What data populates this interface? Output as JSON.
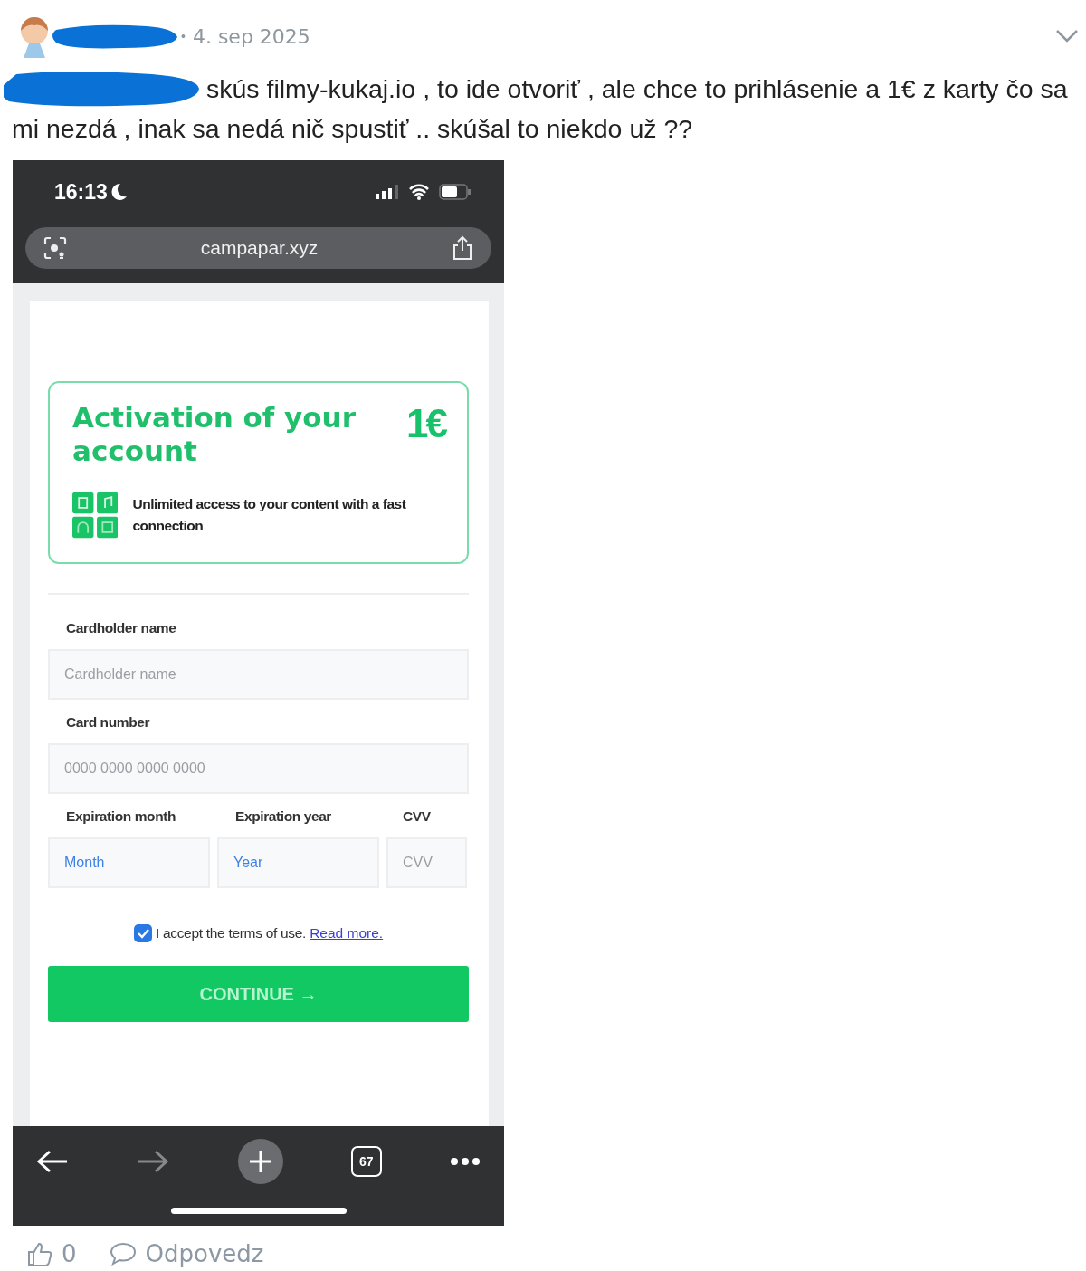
{
  "post": {
    "date": "4. sep 2025",
    "separator": "•",
    "text_lines": [
      "skús filmy-kukaj.io , to ide otvoriť , ale chce to prihlásenie a 1€ z karty čo sa",
      "mi nezdá , inak sa nedá nič spustiť .. skúšal to niekdo už ??"
    ]
  },
  "phone": {
    "time": "16:13",
    "url": "campapar.xyz",
    "card": {
      "title": "Activation of your account",
      "price": "1€",
      "feature": "Unlimited access to your content with a fast connection"
    },
    "field_rows": [
      [
        {
          "kind": "text",
          "label": "Cardholder name",
          "placeholder": "Cardholder name"
        }
      ],
      [
        {
          "kind": "text",
          "label": "Card number",
          "placeholder": "0000 0000 0000 0000"
        }
      ],
      [
        {
          "kind": "select",
          "label": "Expiration month",
          "value": "Month"
        },
        {
          "kind": "select",
          "label": "Expiration year",
          "value": "Year"
        },
        {
          "kind": "text",
          "label": "CVV",
          "placeholder": "CVV"
        }
      ]
    ],
    "terms": {
      "checked": true,
      "text": "I accept the terms of use.",
      "link": "Read more."
    },
    "button": "CONTINUE →",
    "tab_count": "67"
  },
  "footer": {
    "likes": "0",
    "reply": "Odpovedz"
  }
}
